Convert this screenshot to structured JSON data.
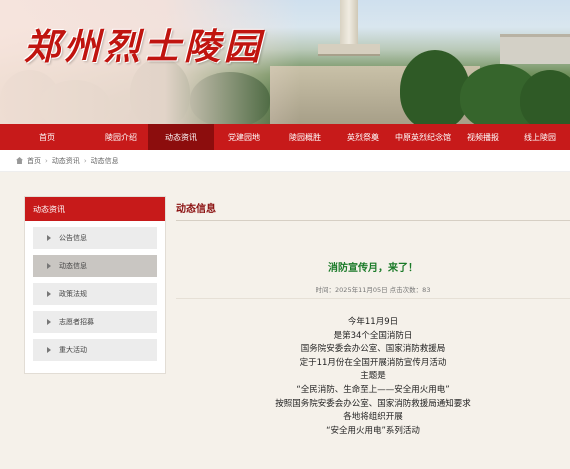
{
  "header": {
    "site_title": "郑州烈士陵园"
  },
  "nav": {
    "items": [
      "首页",
      "陵园介绍",
      "动态资讯",
      "党建园地",
      "陵园概胜",
      "英烈祭奠",
      "中原英烈纪念馆",
      "视频播报",
      "线上陵园"
    ],
    "active_index": 2
  },
  "breadcrumb": {
    "items": [
      "首页",
      "动态资讯",
      "动态信息"
    ]
  },
  "sidebar": {
    "heading": "动态资讯",
    "items": [
      "公告信息",
      "动态信息",
      "政策法规",
      "志愿者招募",
      "重大活动"
    ],
    "active_index": 1
  },
  "main": {
    "section_title": "动态信息",
    "article_title": "消防宣传月，来了！",
    "meta": "时间：2025年11月05日 点击次数：83",
    "lines": [
      "今年11月9日",
      "是第34个全国消防日",
      "国务院安委会办公室、国家消防救援局",
      "定于11月份在全国开展消防宣传月活动",
      "主题是",
      "“全民消防、生命至上——安全用火用电”",
      "按照国务院安委会办公室、国家消防救援局通知要求",
      "各地将组织开展",
      "“安全用火用电”系列活动"
    ]
  },
  "colors": {
    "brand_red": "#c71a1a",
    "active_red": "#8c0d0d",
    "title_green": "#1a7a28"
  }
}
